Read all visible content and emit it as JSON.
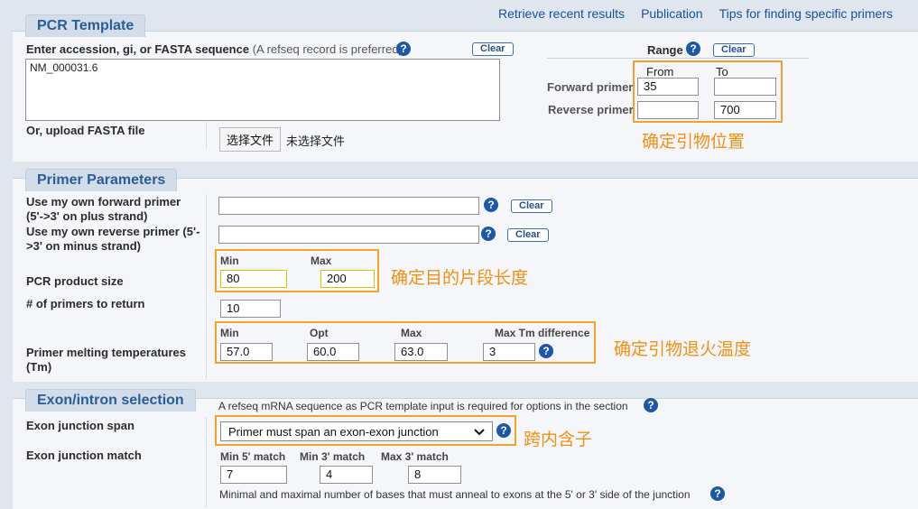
{
  "top_links": [
    "Retrieve recent results",
    "Publication",
    "Tips for finding specific primers"
  ],
  "pcr_template": {
    "title": "PCR Template",
    "accession_label": "Enter accession, gi, or FASTA sequence",
    "accession_hint": "(A refseq record is preferred)",
    "accession_value": "NM_000031.6",
    "clear_label": "Clear",
    "upload_label": "Or, upload FASTA file",
    "file_button": "选择文件",
    "file_status": "未选择文件",
    "range_label": "Range",
    "range_clear": "Clear",
    "from_label": "From",
    "to_label": "To",
    "forward_label": "Forward primer",
    "reverse_label": "Reverse primer",
    "forward_from": "35",
    "forward_to": "",
    "reverse_from": "",
    "reverse_to": "700",
    "annotation": "确定引物位置"
  },
  "primer_params": {
    "title": "Primer Parameters",
    "own_forward_label": "Use my own forward primer (5'->3' on plus strand)",
    "own_forward_value": "",
    "own_reverse_label": "Use my own reverse primer (5'->3' on minus strand)",
    "own_reverse_value": "",
    "clear_label": "Clear",
    "product_size_label": "PCR product size",
    "min_label": "Min",
    "max_label": "Max",
    "product_min": "80",
    "product_max": "200",
    "product_annotation": "确定目的片段长度",
    "num_primers_label": "# of primers to return",
    "num_primers_value": "10",
    "tm_label": "Primer melting temperatures (Tm)",
    "tm_min_label": "Min",
    "tm_opt_label": "Opt",
    "tm_max_label": "Max",
    "tm_diff_label": "Max Tm difference",
    "tm_min": "57.0",
    "tm_opt": "60.0",
    "tm_max": "63.0",
    "tm_diff": "3",
    "tm_annotation": "确定引物退火温度"
  },
  "exon_intron": {
    "title": "Exon/intron selection",
    "requirement_note": "A refseq mRNA sequence as PCR template input is required for options in the section",
    "junction_span_label": "Exon junction span",
    "junction_span_value": "Primer must span an exon-exon junction",
    "span_annotation": "跨内含子",
    "junction_match_label": "Exon junction match",
    "min5_label": "Min 5' match",
    "min3_label": "Min 3' match",
    "max3_label": "Max 3' match",
    "min5": "7",
    "min3": "4",
    "max3": "8",
    "match_note": "Minimal and maximal number of bases that must anneal to exons at the 5' or 3' side of the junction"
  },
  "icons": {
    "help": "help-icon",
    "dropdown": "chevron-down-icon"
  },
  "colors": {
    "annotation": "#f09015",
    "section_title": "#2a5d95",
    "link": "#1a4f98"
  }
}
